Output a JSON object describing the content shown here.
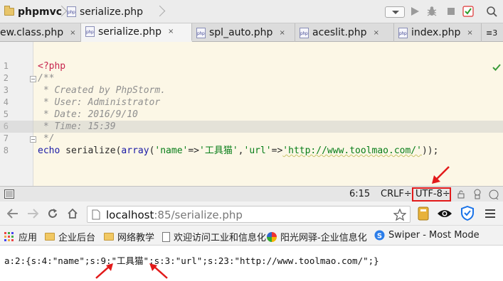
{
  "ide": {
    "breadcrumbs": [
      {
        "label": "phpmvc",
        "icon": "folder-icon"
      },
      {
        "label": "serialize.php",
        "icon": "php-file-icon"
      }
    ],
    "tabs": [
      {
        "label": "ew.class.php",
        "active": false
      },
      {
        "label": "serialize.php",
        "active": true
      },
      {
        "label": "spl_auto.php",
        "active": false
      },
      {
        "label": "aceslit.php",
        "active": false
      },
      {
        "label": "index.php",
        "active": false
      }
    ],
    "tab_overflow": "≡3",
    "tab_close_glyph": "×",
    "code_lines": [
      {
        "num": "1",
        "text": "<?php"
      },
      {
        "num": "2",
        "text": "/**"
      },
      {
        "num": "3",
        "text": " * Created by PhpStorm."
      },
      {
        "num": "4",
        "text": " * User: Administrator"
      },
      {
        "num": "5",
        "text": " * Date: 2016/9/10"
      },
      {
        "num": "6",
        "text": " * Time: 15:39"
      },
      {
        "num": "7",
        "text": " */"
      },
      {
        "num": "8",
        "text": "echo serialize(array('name'=>'工具猫','url'=>'http://www.toolmao.com/'));"
      }
    ],
    "code_line8_parts": {
      "kw_echo": "echo",
      "fn": " serialize",
      "p1": "(",
      "kw_array": "array",
      "p2": "(",
      "s1": "'name'",
      "arrow1": "=>",
      "s2": "'工具猫'",
      "comma": ",",
      "s3": "'url'",
      "arrow2": "=>",
      "s4": "'http://www.toolmao.com/'",
      "end": "));"
    },
    "status": {
      "position": "6:15",
      "line_sep": "CRLF÷",
      "encoding": "UTF-8÷"
    }
  },
  "browser": {
    "url_host": "localhost",
    "url_rest": ":85/serialize.php",
    "bookmarks": [
      {
        "label": "应用",
        "icon": "apps-grid-icon"
      },
      {
        "label": "企业后台",
        "icon": "folder-icon"
      },
      {
        "label": "网络教学",
        "icon": "folder-icon"
      },
      {
        "label": "欢迎访问工业和信息化",
        "icon": "page-icon"
      },
      {
        "label": "阳光网驿-企业信息化",
        "icon": "pinwheel-icon"
      },
      {
        "label": "Swiper - Most Mode",
        "icon": "swiper-s-icon"
      }
    ],
    "output_text": "a:2:{s:4:\"name\";s:9:\"工具猫\";s:3:\"url\";s:23:\"http://www.toolmao.com/\";}"
  },
  "colors": {
    "annotation_red": "#e21a1a",
    "code_bg": "#fcf7e6",
    "string_green": "#067d17",
    "keyword_blue": "#1a1aa6",
    "tag_red": "#c7254e"
  }
}
